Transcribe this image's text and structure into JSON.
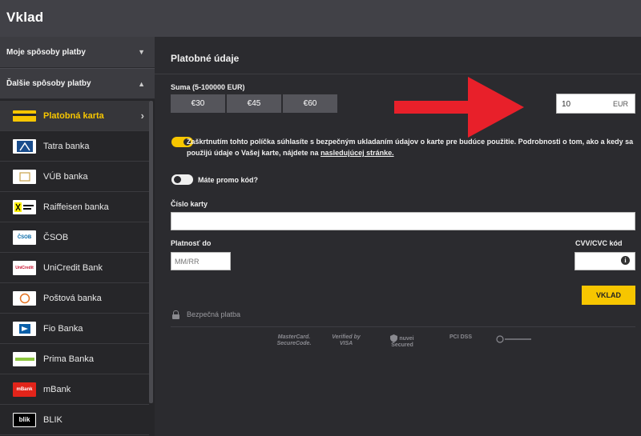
{
  "header": {
    "title": "Vklad"
  },
  "sidebar": {
    "my_methods_label": "Moje spôsoby platby",
    "other_methods_label": "Ďalšie spôsoby platby",
    "items": [
      {
        "label": "Platobná karta",
        "logo": "card-icon",
        "logo_text": ""
      },
      {
        "label": "Tatra banka",
        "logo": "tatra-banka-logo",
        "logo_text": ""
      },
      {
        "label": "VÚB banka",
        "logo": "vub-logo",
        "logo_text": ""
      },
      {
        "label": "Raiffeisen banka",
        "logo": "raiffeisen-logo",
        "logo_text": ""
      },
      {
        "label": "ČSOB",
        "logo": "csob-logo",
        "logo_text": "ČSOB"
      },
      {
        "label": "UniCredit Bank",
        "logo": "unicredit-logo",
        "logo_text": "UniCredit"
      },
      {
        "label": "Poštová banka",
        "logo": "postova-banka-logo",
        "logo_text": ""
      },
      {
        "label": "Fio Banka",
        "logo": "fio-logo",
        "logo_text": ""
      },
      {
        "label": "Prima Banka",
        "logo": "prima-banka-logo",
        "logo_text": ""
      },
      {
        "label": "mBank",
        "logo": "mbank-logo",
        "logo_text": "mBank"
      },
      {
        "label": "BLIK",
        "logo": "blik-logo",
        "logo_text": "blik"
      }
    ]
  },
  "form": {
    "title": "Platobné údaje",
    "amount_label": "Suma (5-100000 EUR)",
    "preset_amounts": [
      "€30",
      "€45",
      "€60"
    ],
    "amount_value": "10",
    "currency": "EUR",
    "consent_text": "Zaškrtnutím tohto políčka súhlasíte s bezpečným ukladaním údajov o karte pre budúce použitie. Podrobnosti o tom, ako a kedy sa použijú údaje o Vašej karte, nájdete na ",
    "consent_link": "nasledujúcej stránke.",
    "promo_label": "Máte promo kód?",
    "card_number_label": "Číslo karty",
    "expiry_label": "Platnosť do",
    "expiry_placeholder": "MM/RR",
    "cvv_label": "CVV/CVC kód",
    "submit_label": "VKLAD",
    "secure_label": "Bezpečná platba"
  },
  "trust_badges": [
    "MasterCard. SecureCode.",
    "Verified by VISA",
    "nuvei Secured",
    "PCI DSS",
    ""
  ],
  "colors": {
    "accent": "#f7c600",
    "arrow": "#e8202a"
  }
}
